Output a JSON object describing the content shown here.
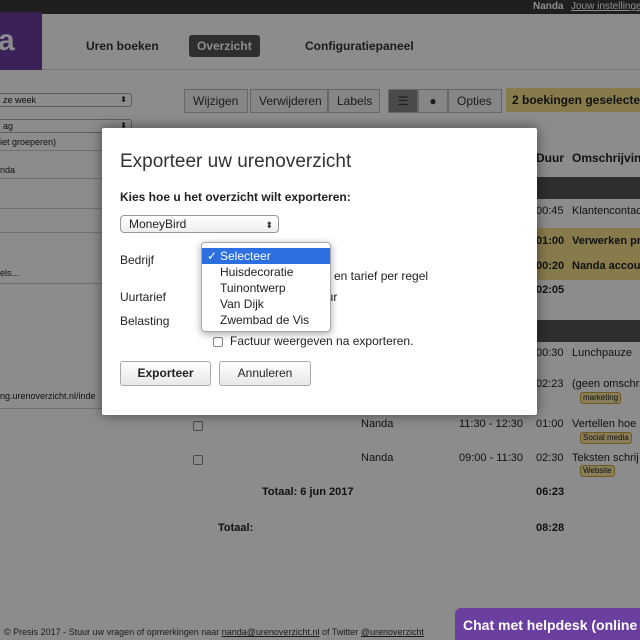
{
  "topbar": {
    "user": "Nanda",
    "settings_link": "Jouw instellingen"
  },
  "logo": {
    "text": "a"
  },
  "nav": {
    "items": [
      "Uren boeken",
      "Overzicht",
      "Configuratiepaneel"
    ],
    "active": "Overzicht"
  },
  "left_panel": {
    "period_select": "ze week",
    "group_select": "ag",
    "group_note": "iet groeperen)",
    "user_value": "nda",
    "labels_placeholder": "els...",
    "url_text": "ng.urenoverzicht.nl/inde"
  },
  "toolbar": {
    "buttons": [
      "Wijzigen",
      "Verwijderen",
      "Labels",
      "Opties"
    ],
    "list_icon": "list-icon",
    "dot_icon": "circle-icon",
    "selected_banner": "2 boekingen geselecte"
  },
  "table": {
    "headers": [
      "Duur",
      "Omschrijvin"
    ],
    "rows": [
      {
        "duur": "00:45",
        "desc": "Klantencontac"
      },
      {
        "duur": "01:00",
        "desc": "Verwerken pr"
      },
      {
        "duur": "00:20",
        "desc": "Nanda accou"
      },
      {
        "duur": "02:05",
        "desc": ""
      },
      {
        "duur": "00:30",
        "desc": "Lunchpauze"
      },
      {
        "duur": "02:23",
        "desc": "(geen omschri",
        "tag": "marketing"
      },
      {
        "user": "Nanda",
        "time": "11:30 - 12:30",
        "duur": "01:00",
        "desc": "Vertellen hoe",
        "tag": "Social media"
      },
      {
        "user": "Nanda",
        "time": "09:00 - 11:30",
        "duur": "02:30",
        "desc": "Teksten schrij",
        "tag": "Website"
      }
    ],
    "day_total_label": "Totaal: 6 jun 2017",
    "day_total_value": "06:23",
    "total_label": "Totaal:",
    "total_value": "08:28"
  },
  "modal": {
    "title": "Exporteer uw urenoverzicht",
    "subtitle": "Kies hoe u het overzicht wilt exporteren:",
    "export_select": "MoneyBird",
    "bedrijf_label": "Bedrijf",
    "uurtarief_label": "Uurtarief",
    "belasting_label": "Belasting",
    "tariff_option_text": "en tarief per regel",
    "uur_text": "uur",
    "checkbox_label": "Factuur weergeven na exporteren.",
    "export_button": "Exporteer",
    "cancel_button": "Annuleren"
  },
  "dropdown": {
    "options": [
      "Selecteer",
      "Huisdecoratie",
      "Tuinontwerp",
      "Van Dijk",
      "Zwembad de Vis"
    ],
    "selected": "Selecteer",
    "check_mark": "✓"
  },
  "footer": {
    "text_prefix": "© Presis 2017 - Stuur uw vragen of opmerkingen naar ",
    "email": "nanda@urenoverzicht.nl",
    "text_mid": " of Twitter ",
    "twitter": "@urenoverzicht"
  },
  "chat": {
    "label": "Chat met helpdesk (online"
  },
  "colors": {
    "brand": "#6b3fa0",
    "highlight": "#f6e08a",
    "select_blue": "#2c6fe0"
  }
}
